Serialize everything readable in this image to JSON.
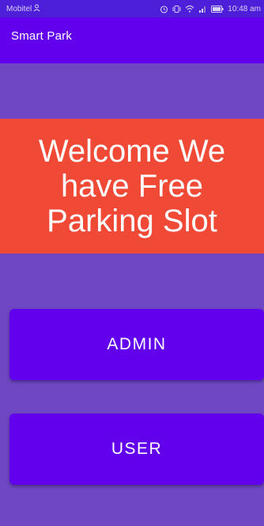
{
  "status_bar": {
    "carrier": "Mobitel",
    "time": "10:48 am",
    "icons": [
      "alarm-icon",
      "vibrate-icon",
      "wifi-icon",
      "signal-icon",
      "battery-icon"
    ]
  },
  "app_bar": {
    "title": "Smart Park"
  },
  "banner": {
    "text": "Welcome We have Free Parking Slot"
  },
  "buttons": {
    "admin_label": "ADMIN",
    "user_label": "USER"
  },
  "colors": {
    "background": "#6f47c4",
    "status_bar": "#4d1fd8",
    "app_bar": "#6200ee",
    "banner": "#f04a36",
    "button": "#6200ee",
    "text": "#ffffff"
  }
}
